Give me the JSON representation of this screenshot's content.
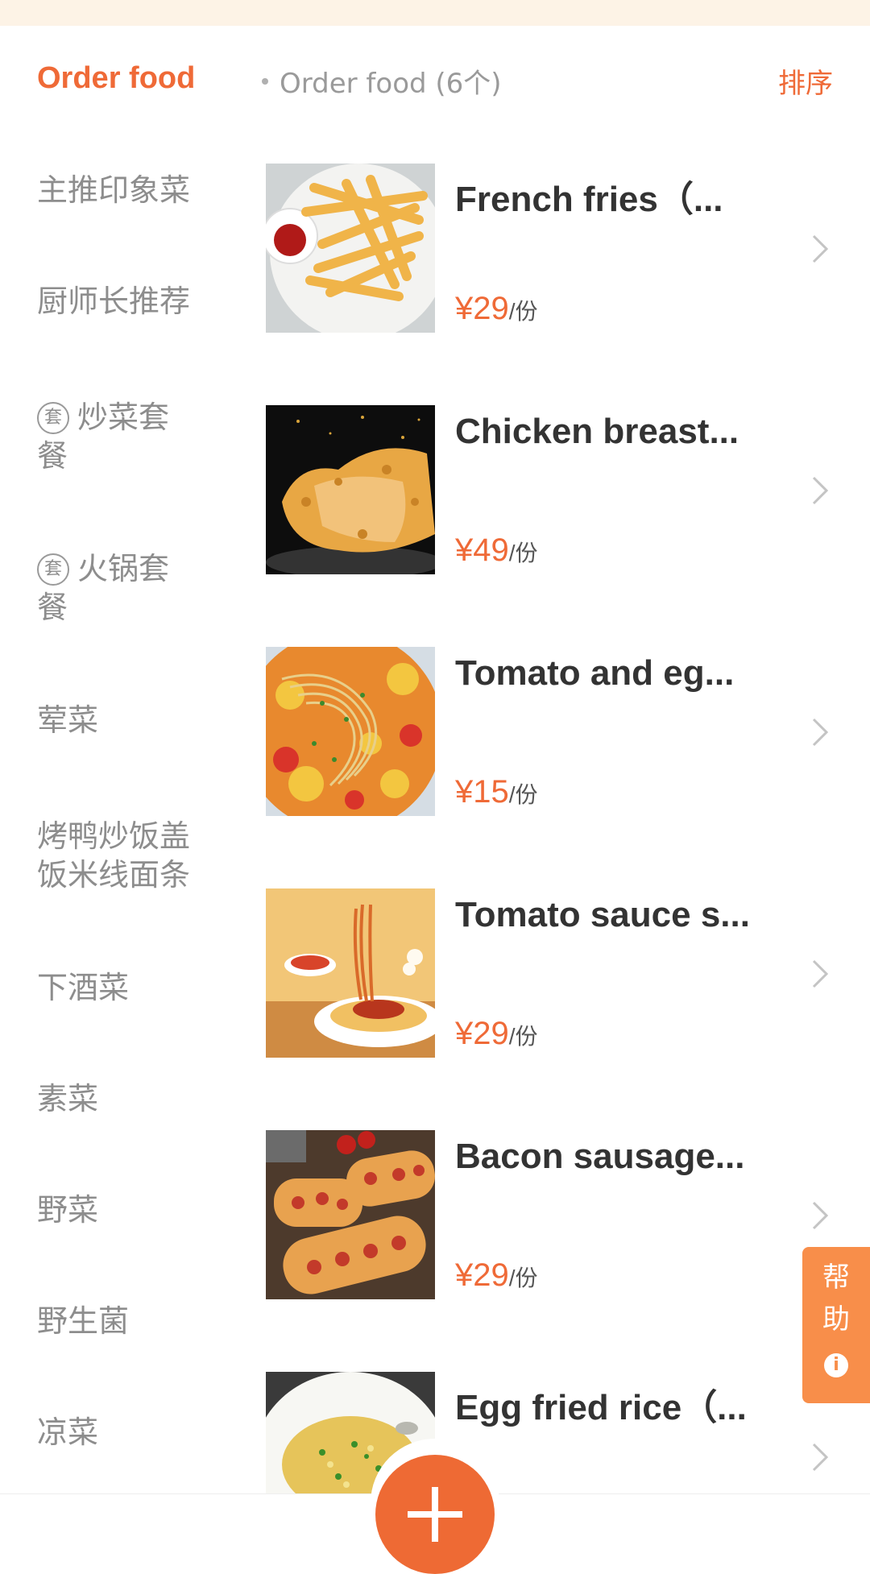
{
  "sidebar": {
    "title": "Order food",
    "categories": [
      {
        "label": "主推印象菜"
      },
      {
        "label": "厨师长推荐"
      },
      {
        "badge": "套",
        "label": "炒菜套",
        "label2": "餐"
      },
      {
        "badge": "套",
        "label": "火锅套",
        "label2": "餐"
      },
      {
        "label": "荤菜"
      },
      {
        "label": "烤鸭炒饭盖",
        "label2": "饭米线面条"
      },
      {
        "label": "下酒菜"
      },
      {
        "label": "素菜"
      },
      {
        "label": "野菜"
      },
      {
        "label": "野生菌"
      },
      {
        "label": "凉菜"
      }
    ]
  },
  "list": {
    "header": "Order food (6个)",
    "sort_label": "排序",
    "items": [
      {
        "name": "French fries（...",
        "price": "¥29",
        "unit": "/份"
      },
      {
        "name": "Chicken breast...",
        "price": "¥49",
        "unit": "/份"
      },
      {
        "name": "Tomato and eg...",
        "price": "¥15",
        "unit": "/份"
      },
      {
        "name": "Tomato sauce s...",
        "price": "¥29",
        "unit": "/份"
      },
      {
        "name": "Bacon sausage...",
        "price": "¥29",
        "unit": "/份"
      },
      {
        "name": "Egg fried rice（...",
        "price": "",
        "unit": ""
      }
    ]
  },
  "help": {
    "line1": "帮",
    "line2": "助",
    "info": "i"
  },
  "colors": {
    "accent": "#ef6a37",
    "help_tab": "#f88e4a"
  }
}
